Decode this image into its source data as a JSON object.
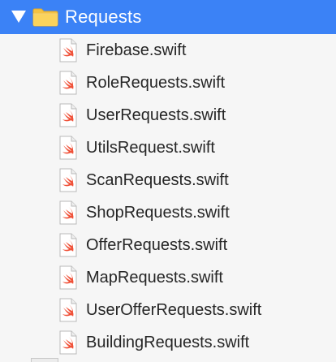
{
  "colors": {
    "selection": "#3b82f6",
    "swift_accent": "#f05138"
  },
  "folder": {
    "name": "Requests",
    "expanded": true,
    "icon": "folder-icon",
    "disclosure_icon": "disclosure-triangle-down-icon"
  },
  "files": [
    {
      "name": "Firebase.swift",
      "icon": "swift-file-icon"
    },
    {
      "name": "RoleRequests.swift",
      "icon": "swift-file-icon"
    },
    {
      "name": "UserRequests.swift",
      "icon": "swift-file-icon"
    },
    {
      "name": "UtilsRequest.swift",
      "icon": "swift-file-icon"
    },
    {
      "name": "ScanRequests.swift",
      "icon": "swift-file-icon"
    },
    {
      "name": "ShopRequests.swift",
      "icon": "swift-file-icon"
    },
    {
      "name": "OfferRequests.swift",
      "icon": "swift-file-icon"
    },
    {
      "name": "MapRequests.swift",
      "icon": "swift-file-icon"
    },
    {
      "name": "UserOfferRequests.swift",
      "icon": "swift-file-icon"
    },
    {
      "name": "BuildingRequests.swift",
      "icon": "swift-file-icon"
    }
  ]
}
